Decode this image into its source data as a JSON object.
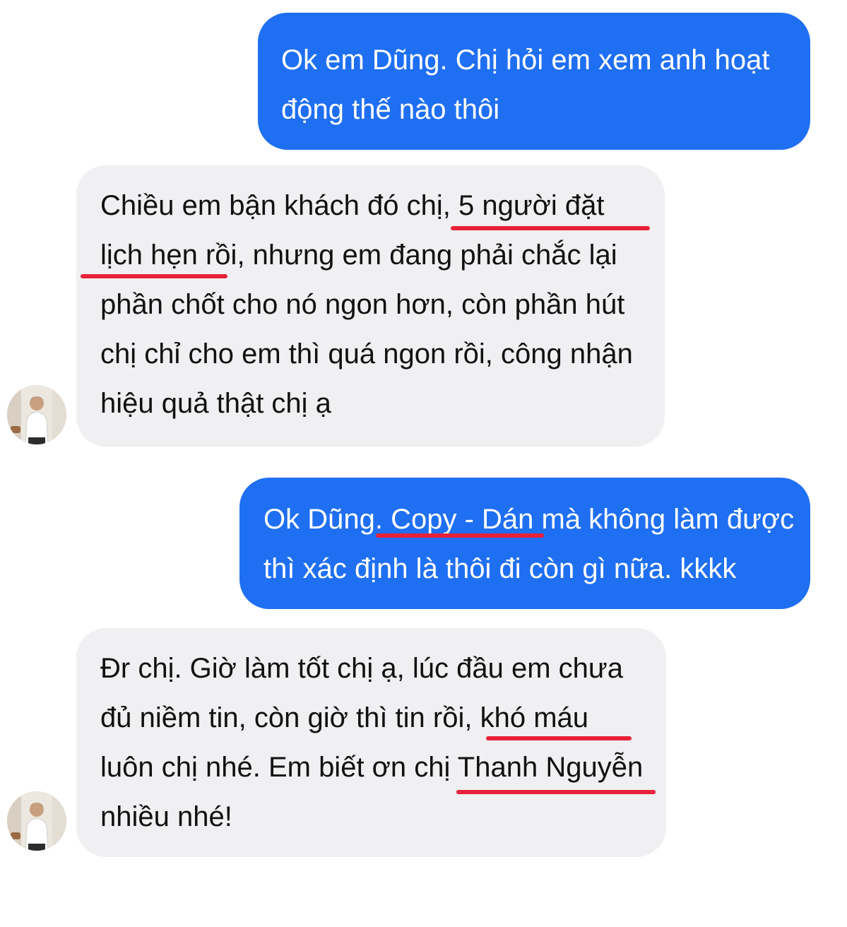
{
  "messages": [
    {
      "direction": "outgoing",
      "lines": [
        "Ok em Dũng. Chị hỏi em xem anh hoạt",
        "động thế nào thôi"
      ]
    },
    {
      "direction": "incoming",
      "lines": [
        "Chiều em bận khách đó chị, 5 người đặt",
        "lịch hẹn rồi, nhưng em đang phải chắc lại",
        "phần chốt cho nó ngon hơn, còn phần hút",
        "chị chỉ cho em thì quá ngon rồi, công nhận",
        "hiệu quả thật chị ạ"
      ]
    },
    {
      "direction": "outgoing",
      "lines": [
        "Ok Dũng. Copy - Dán mà không làm được",
        "thì xác định là thôi đi còn gì nữa. kkkk"
      ]
    },
    {
      "direction": "incoming",
      "lines": [
        "Đr chị. Giờ làm tốt chị ạ, lúc đầu em chưa",
        "đủ niềm tin, còn giờ thì tin rồi, khó máu",
        "luôn chị nhé. Em biết ơn chị Thanh Nguyễn",
        "nhiều nhé!"
      ]
    }
  ],
  "avatar_icon": "person-avatar-icon",
  "colors": {
    "outgoing_bubble": "#1f6ff2",
    "incoming_bubble": "#f0f0f2",
    "highlight_underline": "#e8213a"
  }
}
